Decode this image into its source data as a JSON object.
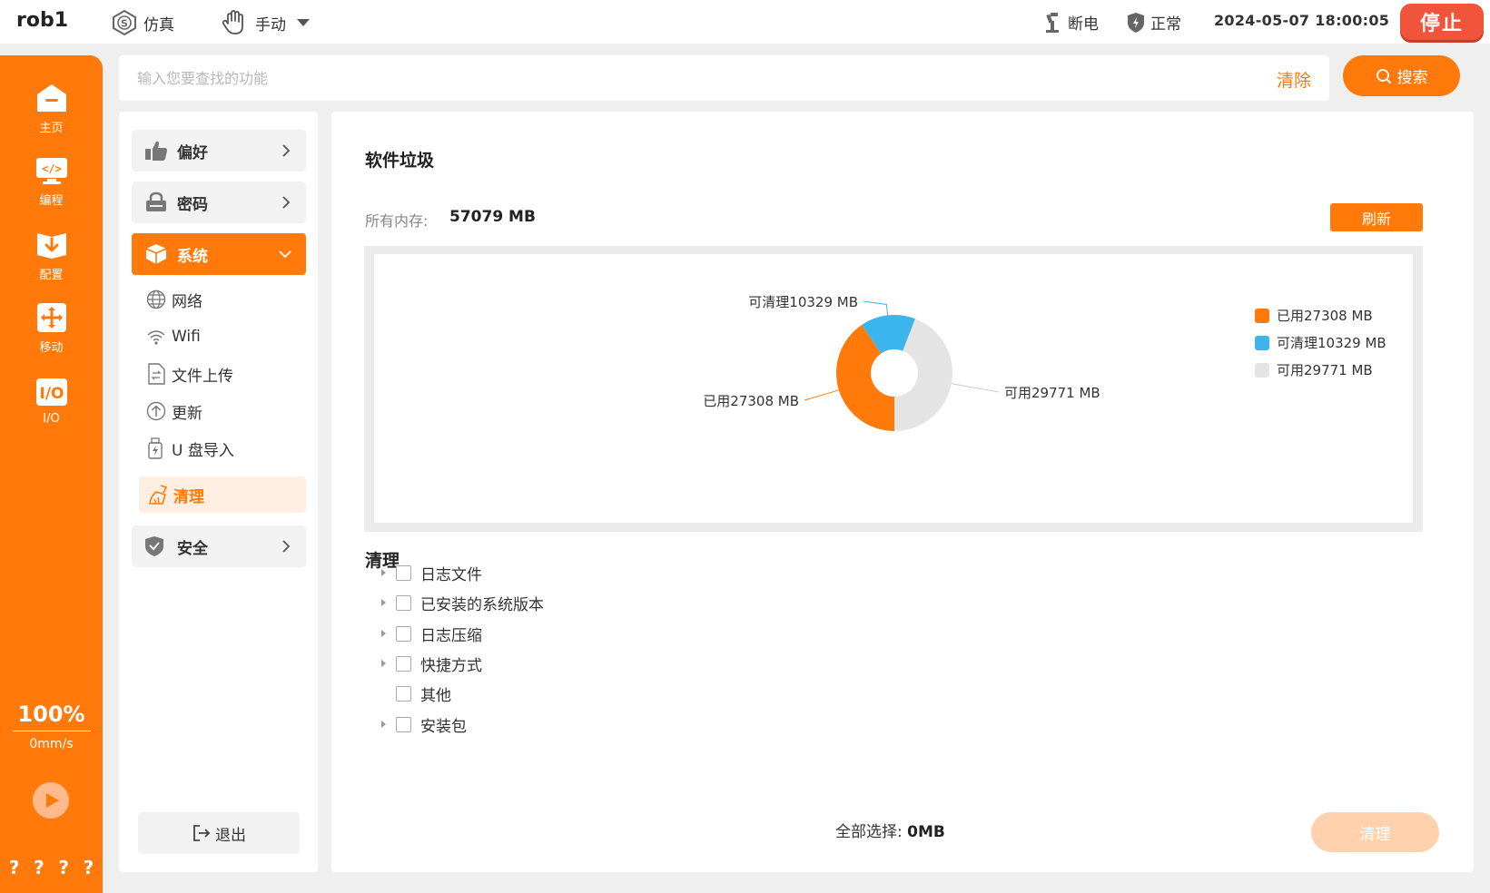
{
  "topbar": {
    "robot_name": "rob1",
    "mode_sim": "仿真",
    "mode_manual": "手动",
    "power": "断电",
    "status": "正常",
    "datetime": "2024-05-07 18:00:05",
    "stop": "停止"
  },
  "leftnav": {
    "items": [
      {
        "label": "主页",
        "icon": "home-icon"
      },
      {
        "label": "编程",
        "icon": "code-icon"
      },
      {
        "label": "配置",
        "icon": "download-icon"
      },
      {
        "label": "移动",
        "icon": "move-icon"
      },
      {
        "label": "I/O",
        "icon": "io-icon"
      }
    ],
    "speed_percent": "100%",
    "speed_value": "0mm/s",
    "qmarks": [
      "?",
      "?",
      "?",
      "?"
    ]
  },
  "search": {
    "placeholder": "输入您要查找的功能",
    "value": "",
    "clear": "清除",
    "button": "搜索"
  },
  "menu": {
    "groups": [
      {
        "label": "偏好",
        "icon": "thumbs-up-icon"
      },
      {
        "label": "密码",
        "icon": "lock-icon"
      },
      {
        "label": "系统",
        "icon": "cube-icon"
      },
      {
        "label": "安全",
        "icon": "shield-icon"
      }
    ],
    "sub_items": [
      {
        "label": "网络",
        "icon": "globe-icon"
      },
      {
        "label": "Wifi",
        "icon": "wifi-icon"
      },
      {
        "label": "文件上传",
        "icon": "file-upload-icon"
      },
      {
        "label": "更新",
        "icon": "update-icon"
      },
      {
        "label": "U 盘导入",
        "icon": "usb-icon"
      },
      {
        "label": "清理",
        "icon": "broom-icon"
      }
    ],
    "logout": "退出"
  },
  "main": {
    "title": "软件垃圾",
    "mem_label": "所有内存:",
    "mem_value": "57079 MB",
    "refresh": "刷新",
    "section_title": "清理",
    "tree": [
      {
        "label": "日志文件",
        "expandable": true
      },
      {
        "label": "已安装的系统版本",
        "expandable": true
      },
      {
        "label": "日志压缩",
        "expandable": true
      },
      {
        "label": "快捷方式",
        "expandable": true
      },
      {
        "label": "其他",
        "expandable": false
      },
      {
        "label": "安装包",
        "expandable": true
      }
    ],
    "select_all_label": "全部选择:",
    "select_all_value": "0MB",
    "clean_button": "清理"
  },
  "chart_data": {
    "type": "pie",
    "donut": true,
    "categories": [
      "已用27308 MB",
      "可清理10329 MB",
      "可用29771 MB"
    ],
    "values": [
      27308,
      10329,
      29771
    ],
    "colors": [
      "#ff7a0a",
      "#3cb4ec",
      "#e4e4e4"
    ],
    "legend": "top-right",
    "legend_entries": [
      "已用27308 MB",
      "可清理10329 MB",
      "可用29771 MB"
    ],
    "slice_labels": [
      "已用27308 MB",
      "可清理10329 MB",
      "可用29771 MB"
    ]
  }
}
